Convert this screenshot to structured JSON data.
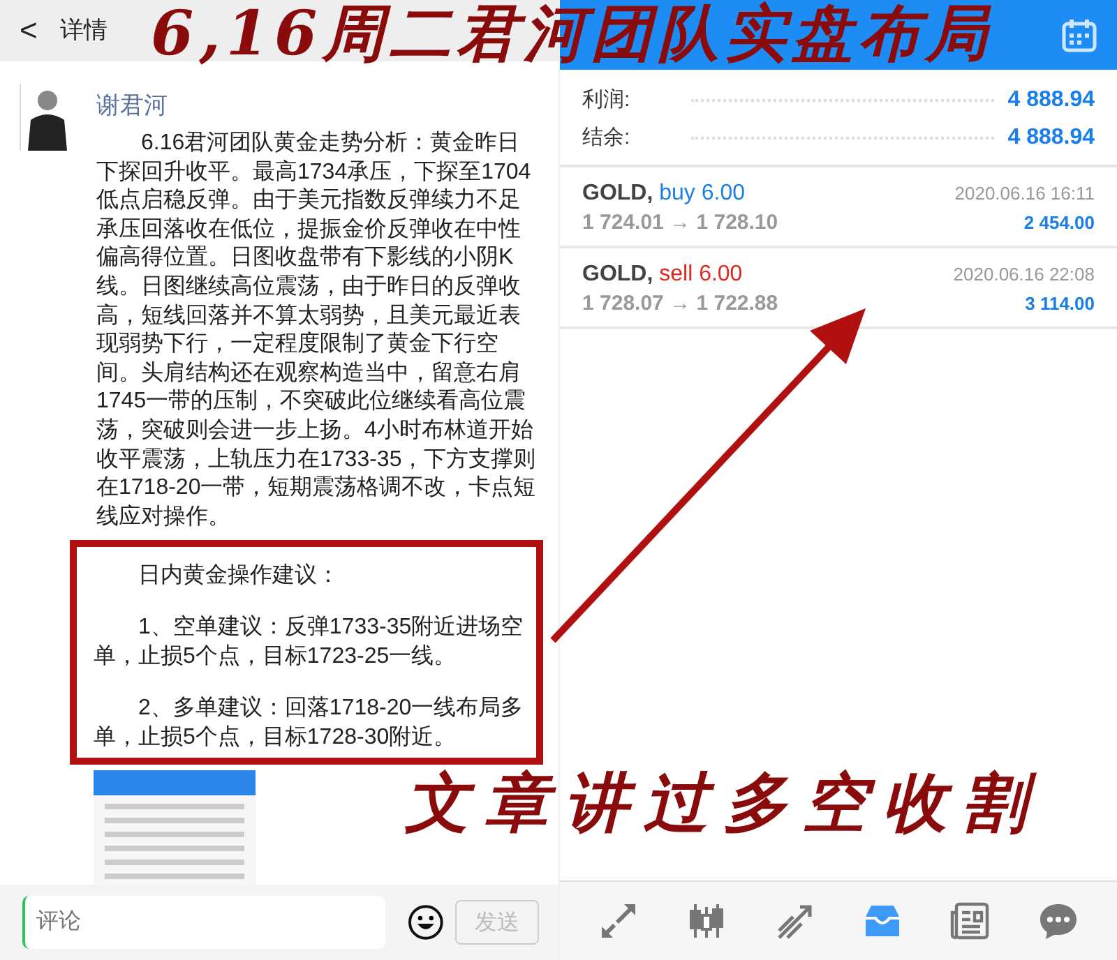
{
  "overlay": {
    "title": "6,16周二君河团队实盘布局",
    "caption": "文章讲过多空收割"
  },
  "post_view": {
    "header": {
      "back": "<",
      "title": "详情"
    },
    "author": "谢君河",
    "body": "6.16君河团队黄金走势分析：黄金昨日下探回升收平。最高1734承压，下探至1704低点启稳反弹。由于美元指数反弹续力不足承压回落收在低位，提振金价反弹收在中性偏高得位置。日图收盘带有下影线的小阴K线。日图继续高位震荡，由于昨日的反弹收高，短线回落并不算太弱势，且美元最近表现弱势下行，一定程度限制了黄金下行空间。头肩结构还在观察构造当中，留意右肩1745一带的压制，不突破此位继续看高位震荡，突破则会进一步上扬。4小时布林道开始收平震荡，上轨压力在1733-35，下方支撑则在1718-20一带，短期震荡格调不改，卡点短线应对操作。",
    "advice": [
      "日内黄金操作建议：",
      "1、空单建议：反弹1733-35附近进场空单，止损5个点，目标1723-25一线。",
      "2、多单建议：回落1718-20一线布局多单，止损5个点，目标1728-30附近。"
    ],
    "comment": {
      "placeholder": "评论",
      "send": "发送",
      "send_disabled": true
    }
  },
  "trade_history": {
    "summary": [
      {
        "label": "利润:",
        "value": "4 888.94"
      },
      {
        "label": "结余:",
        "value": "4 888.94"
      }
    ],
    "trades": [
      {
        "symbol": "GOLD,",
        "kind": "buy",
        "action": "buy 6.00",
        "prices": "1 724.01 → 1 728.10",
        "time": "2020.06.16 16:11",
        "profit": "2 454.00"
      },
      {
        "symbol": "GOLD,",
        "kind": "sell",
        "action": "sell 6.00",
        "prices": "1 728.07 → 1 722.88",
        "time": "2020.06.16 22:08",
        "profit": "3 114.00"
      }
    ],
    "nav": [
      {
        "selected": false
      },
      {
        "selected": false
      },
      {
        "selected": false
      },
      {
        "selected": true
      },
      {
        "selected": false
      },
      {
        "selected": false
      }
    ]
  }
}
